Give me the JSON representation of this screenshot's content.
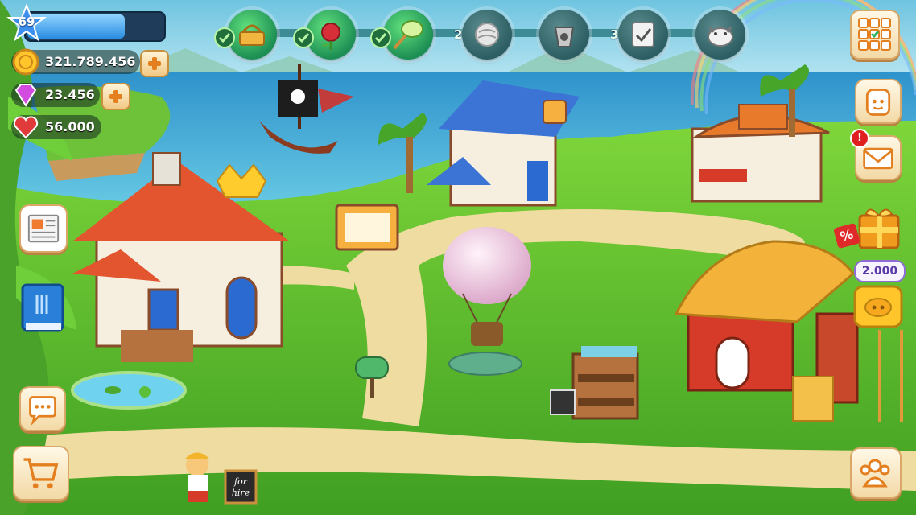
{
  "player": {
    "level": "69",
    "xp_progress": 0.72
  },
  "resources": {
    "coins": "321.789.456",
    "gems": "23.456",
    "hearts": "56.000"
  },
  "quests": [
    {
      "name": "basket",
      "status": "completed"
    },
    {
      "name": "rose",
      "status": "completed"
    },
    {
      "name": "net",
      "status": "completed"
    },
    {
      "name": "wool",
      "status": "locked",
      "count": "2"
    },
    {
      "name": "bucket",
      "status": "locked"
    },
    {
      "name": "checklist",
      "status": "locked",
      "count": "3"
    },
    {
      "name": "cow",
      "status": "locked"
    }
  ],
  "piggy_bank": {
    "amount": "2.000"
  },
  "mail": {
    "alert": "!"
  },
  "shop": {
    "discount_symbol": "%"
  },
  "for_hire_sign": {
    "line1": "for",
    "line2": "hire"
  },
  "icons": {
    "top_right": "calendar-tasks-icon",
    "friends": "friend-face-icon",
    "mail": "envelope-icon",
    "gift": "gift-box-icon",
    "news": "newspaper-icon",
    "book": "recipe-book-icon",
    "chat": "chat-bubble-icon",
    "shop": "shopping-cart-icon",
    "community": "people-group-icon"
  },
  "colors": {
    "grass": "#5cbf2e",
    "path": "#f0dfa4",
    "sea": "#3aa6d8",
    "accent_orange": "#e47f1f",
    "quest_green": "#2fb363"
  }
}
